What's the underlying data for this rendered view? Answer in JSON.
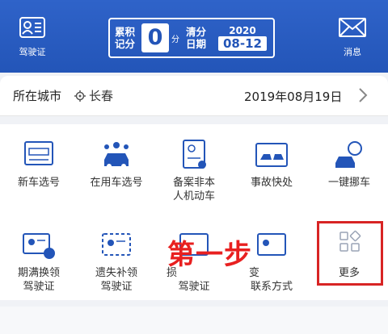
{
  "header": {
    "license_label": "驾驶证",
    "messages_label": "消息",
    "score": {
      "label_line1": "累积",
      "label_line2": "记分",
      "value": "0",
      "unit": "分",
      "clear_line1": "清分",
      "clear_line2": "日期",
      "year": "2020",
      "month_day": "08-12"
    }
  },
  "city_row": {
    "label": "所在城市",
    "city": "长春",
    "date": "2019年08月19日"
  },
  "grid": {
    "items": [
      {
        "line1": "新车选号",
        "line2": ""
      },
      {
        "line1": "在用车选号",
        "line2": ""
      },
      {
        "line1": "备案非本",
        "line2": "人机动车"
      },
      {
        "line1": "事故快处",
        "line2": ""
      },
      {
        "line1": "一键挪车",
        "line2": ""
      },
      {
        "line1": "期满换领",
        "line2": "驾驶证"
      },
      {
        "line1": "遗失补领",
        "line2": "驾驶证"
      },
      {
        "line1": "损",
        "line2": "驾驶证"
      },
      {
        "line1": "变",
        "line2": "联系方式"
      },
      {
        "line1": "更多",
        "line2": ""
      }
    ]
  },
  "overlay_text": "第一步",
  "colors": {
    "brand": "#2355b8",
    "highlight": "#d82424"
  }
}
